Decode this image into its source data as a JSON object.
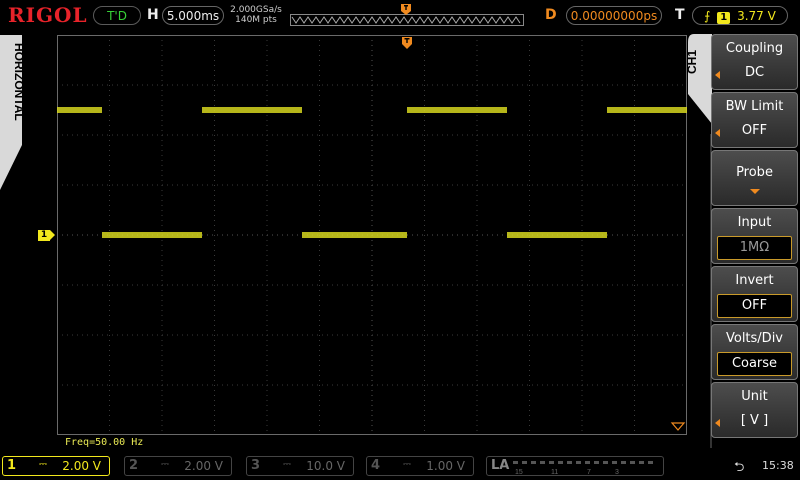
{
  "header": {
    "brand": "RIGOL",
    "trigger_status": "T'D",
    "horizontal_label": "H",
    "timebase": "5.000ms",
    "sample_rate": "2.000GSa/s",
    "memory_depth": "140M pts",
    "delay_label": "D",
    "delay_value": "0.00000000ps",
    "trigger_label": "T",
    "trigger_channel": "1",
    "trigger_level": "3.77 V"
  },
  "side_tab": {
    "label": "HORIZONTAL"
  },
  "channel_tab": {
    "label": "CH1"
  },
  "menu": {
    "coupling": {
      "title": "Coupling",
      "value": "DC"
    },
    "bw_limit": {
      "title": "BW Limit",
      "value": "OFF"
    },
    "probe": {
      "title": "Probe"
    },
    "input": {
      "title": "Input",
      "value": "1MΩ"
    },
    "invert": {
      "title": "Invert",
      "value": "OFF"
    },
    "volts_div": {
      "title": "Volts/Div",
      "value": "Coarse"
    },
    "unit": {
      "title": "Unit",
      "value": "[ V ]"
    }
  },
  "scope": {
    "ch1_marker": "1",
    "frequency": "Freq=50.00 Hz",
    "trace_color": "#d6d61e"
  },
  "channels": [
    {
      "num": "1",
      "scale": "2.00 V",
      "active": true,
      "color": "#f2e81d"
    },
    {
      "num": "2",
      "scale": "2.00 V",
      "active": false
    },
    {
      "num": "3",
      "scale": "10.0 V",
      "active": false
    },
    {
      "num": "4",
      "scale": "1.00 V",
      "active": false
    }
  ],
  "la": {
    "label": "LA",
    "digits": [
      "15",
      "11",
      "7",
      "3"
    ]
  },
  "status": {
    "time": "15:38"
  }
}
